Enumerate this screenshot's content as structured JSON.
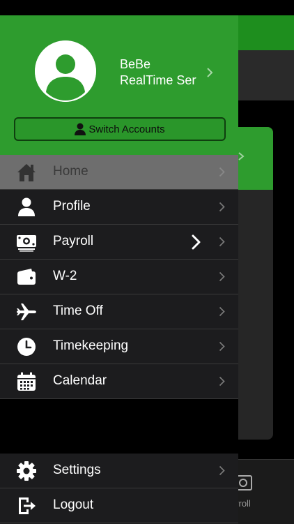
{
  "user": {
    "name": "BeBe",
    "company": "RealTime Services"
  },
  "switch_accounts": {
    "label": "Switch Accounts"
  },
  "menu": [
    {
      "label": "Home",
      "icon": "home-icon",
      "active": true
    },
    {
      "label": "Profile",
      "icon": "person-icon"
    },
    {
      "label": "Payroll",
      "icon": "money-icon"
    },
    {
      "label": "W-2",
      "icon": "wallet-icon"
    },
    {
      "label": "Time Off",
      "icon": "airplane-icon"
    },
    {
      "label": "Timekeeping",
      "icon": "clock-icon"
    },
    {
      "label": "Calendar",
      "icon": "calendar-icon"
    }
  ],
  "bottom_menu": [
    {
      "label": "Settings",
      "icon": "gear-icon"
    },
    {
      "label": "Logout",
      "icon": "logout-icon"
    }
  ],
  "background_tab": {
    "label": "yroll"
  },
  "colors": {
    "brand_green": "#2e9c2e",
    "menu_bg": "#1c1c1e",
    "active_bg": "#6e6e6e"
  }
}
